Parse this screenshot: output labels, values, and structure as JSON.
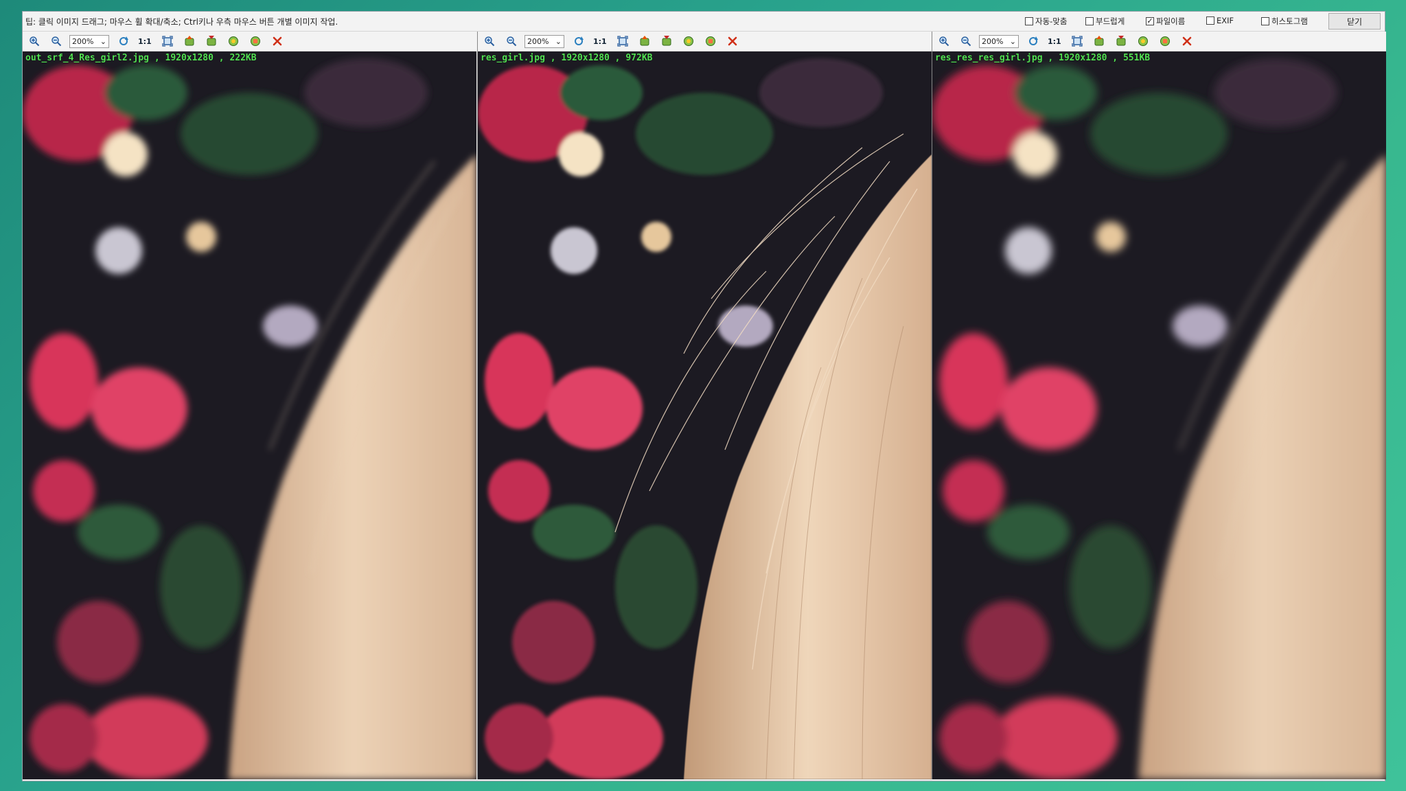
{
  "tip": "팁: 클릭 이미지 드래그; 마우스 휠 확대/축소; Ctrl키나 우측 마우스 버튼 개별 이미지 작업.",
  "options": [
    {
      "label": "자동-맞춤",
      "checked": false
    },
    {
      "label": "부드럽게",
      "checked": false
    },
    {
      "label": "파일이름",
      "checked": true
    },
    {
      "label": "EXIF",
      "checked": false
    },
    {
      "label": "히스토그램",
      "checked": false
    }
  ],
  "close_label": "닫기",
  "toolbar": {
    "zoom_value": "200%",
    "one_to_one": "1:1"
  },
  "panes": [
    {
      "filename": "out_srf_4_Res_girl2.jpg",
      "dims": "1920x1280",
      "size": "222KB",
      "blur": 5
    },
    {
      "filename": "res_girl.jpg",
      "dims": "1920x1280",
      "size": "972KB",
      "blur": 1.5
    },
    {
      "filename": "res_res_res_girl.jpg",
      "dims": "1920x1280",
      "size": "551KB",
      "blur": 6
    }
  ],
  "icons": [
    "zoom-in-icon",
    "zoom-out-icon",
    "rotate-icon",
    "fit-icon",
    "prev-image-icon",
    "next-image-icon",
    "save-icon",
    "copy-icon",
    "close-pane-icon"
  ],
  "colors": {
    "caption": "#52e052",
    "close_x": "#d03018",
    "hair": "#e6c7a6",
    "flower": "#d83a5c",
    "background": "#1c1a22"
  }
}
